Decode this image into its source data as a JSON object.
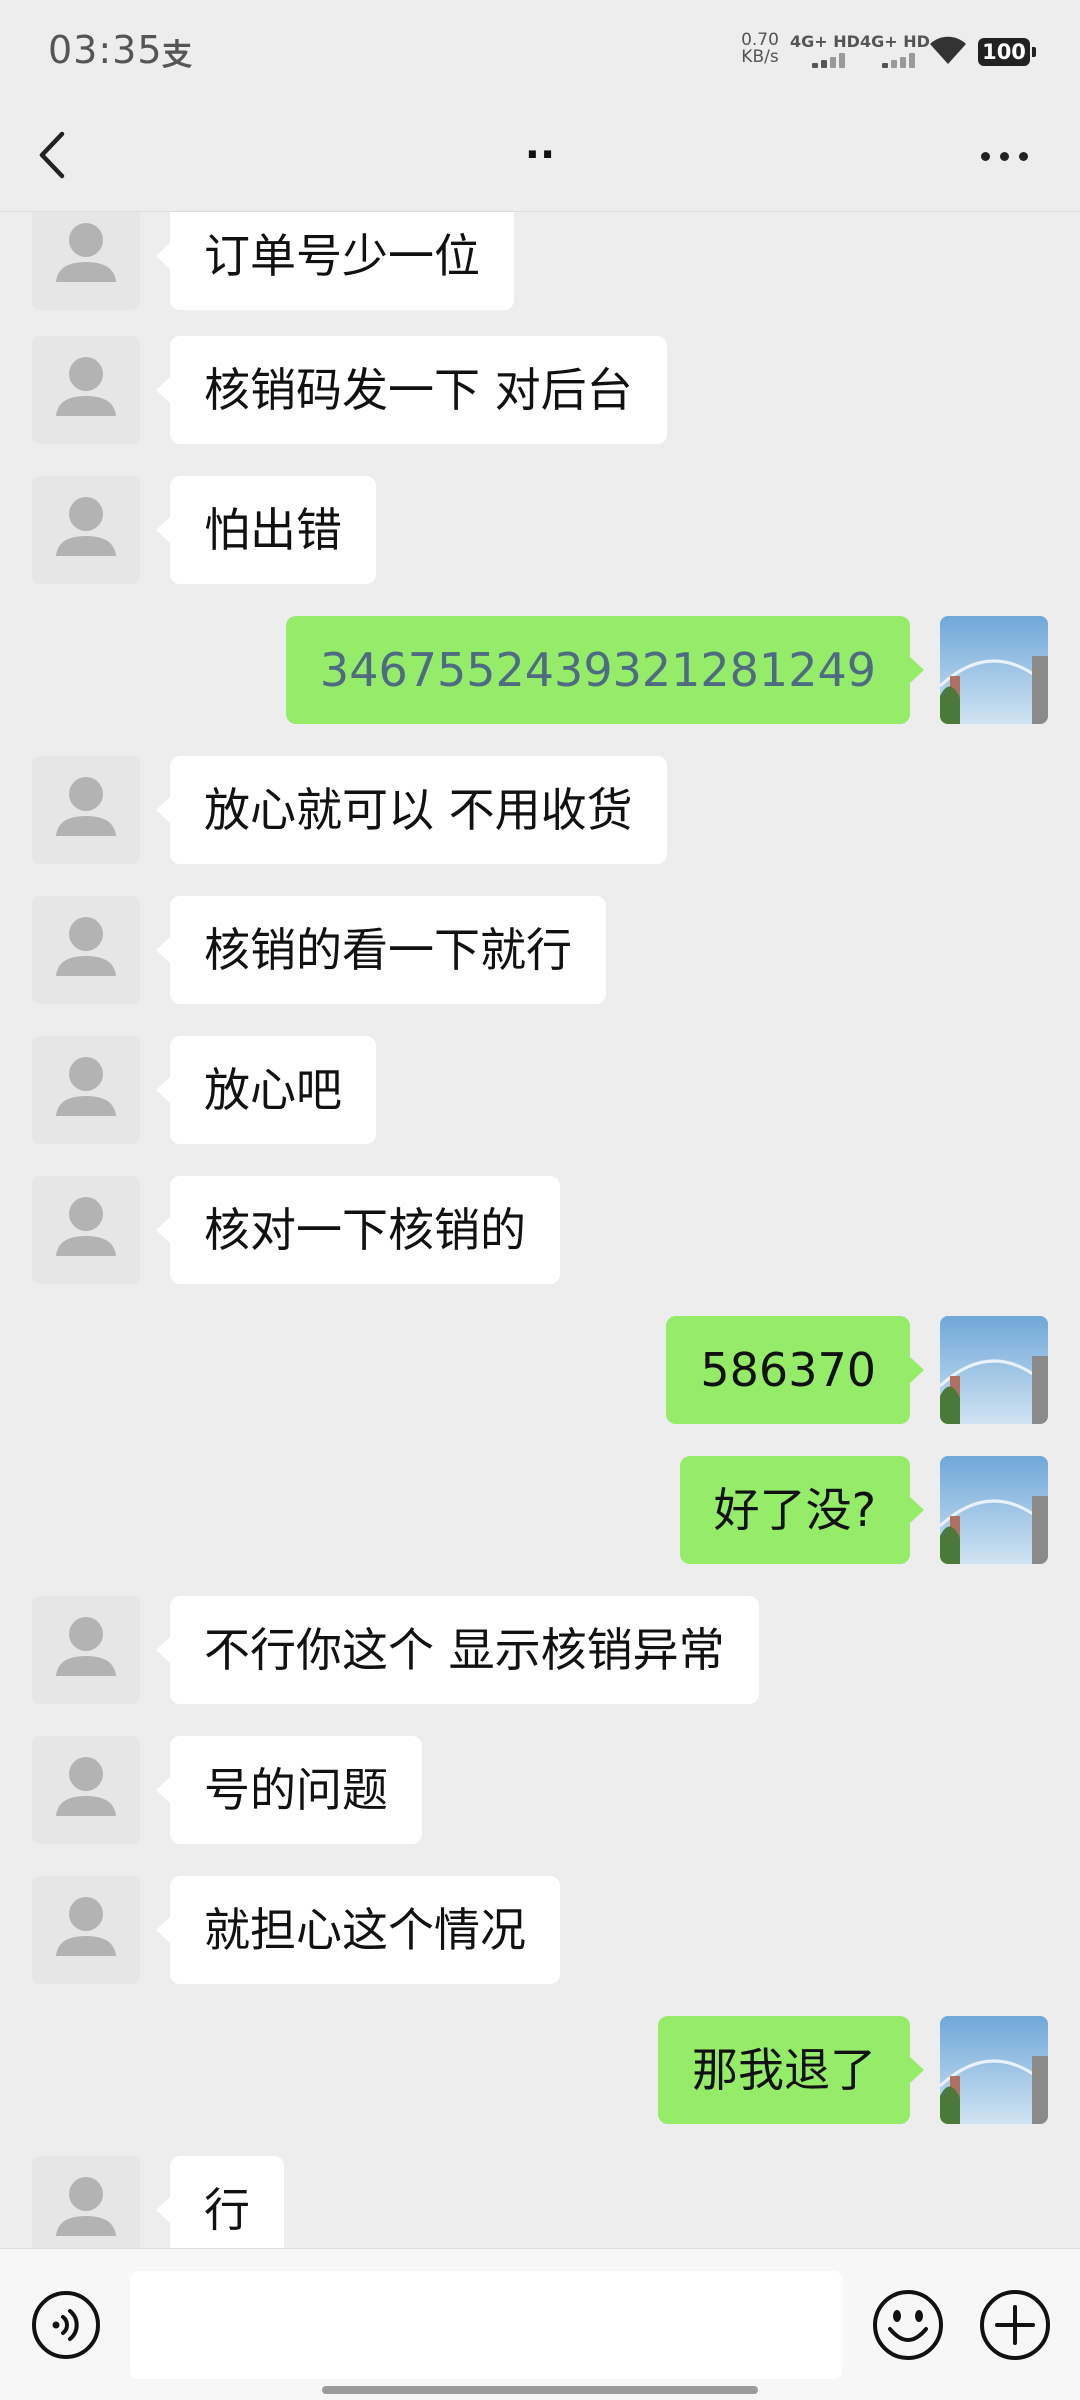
{
  "status_bar": {
    "time": "03:35",
    "alipay_glyph": "支",
    "speed_value": "0.70",
    "speed_unit": "KB/s",
    "network_1": "4G+ HD",
    "network_2": "4G+ HD",
    "battery": "100"
  },
  "header": {
    "back_icon": "chevron-left-icon",
    "title": "..",
    "more_icon": "more-horizontal-icon"
  },
  "messages": [
    {
      "side": "left",
      "text": "订单号少一位"
    },
    {
      "side": "left",
      "text": "核销码发一下 对后台"
    },
    {
      "side": "left",
      "text": "怕出错"
    },
    {
      "side": "right",
      "text": "3467552439321281249"
    },
    {
      "side": "left",
      "text": "放心就可以 不用收货"
    },
    {
      "side": "left",
      "text": "核销的看一下就行"
    },
    {
      "side": "left",
      "text": "放心吧"
    },
    {
      "side": "left",
      "text": "核对一下核销的"
    },
    {
      "side": "right",
      "text": "586370"
    },
    {
      "side": "right",
      "text": "好了没?"
    },
    {
      "side": "left",
      "text": "不行你这个 显示核销异常"
    },
    {
      "side": "left",
      "text": "号的问题"
    },
    {
      "side": "left",
      "text": "就担心这个情况"
    },
    {
      "side": "right",
      "text": "那我退了"
    },
    {
      "side": "left",
      "text": "行"
    }
  ],
  "input_bar": {
    "voice_icon": "voice-icon",
    "input_value": "",
    "emoji_icon": "emoji-icon",
    "plus_icon": "plus-icon"
  },
  "colors": {
    "background": "#ededed",
    "bubble_incoming": "#ffffff",
    "bubble_outgoing": "#95ec69",
    "link_number": "#4f6b83"
  }
}
